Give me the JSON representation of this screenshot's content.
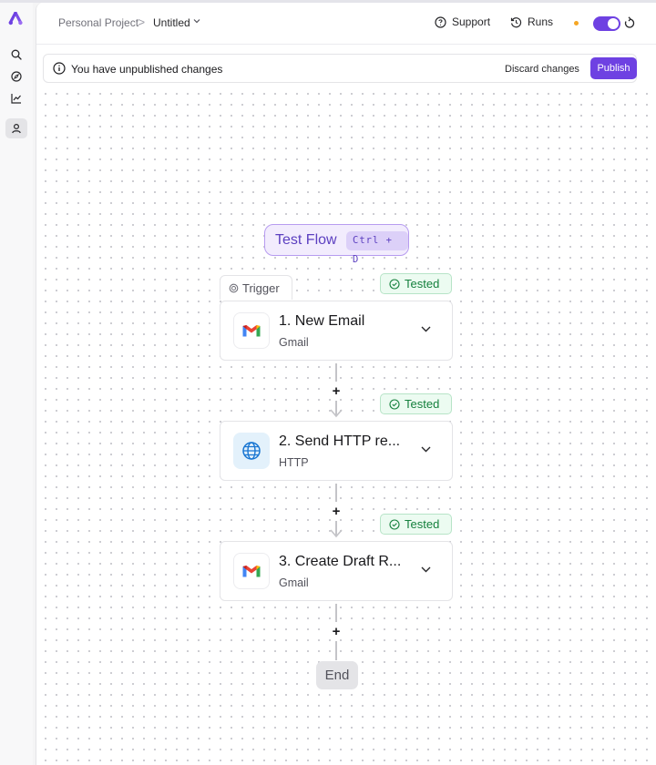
{
  "header": {
    "breadcrumb_project": "Personal Project",
    "breadcrumb_separator": ">",
    "breadcrumb_title": "Untitled",
    "support_label": "Support",
    "runs_label": "Runs",
    "status_dot_color": "#f5a623",
    "toggle_on": true,
    "accent_color": "#6e41e2"
  },
  "sidebar": {
    "items": [
      {
        "icon": "search-icon"
      },
      {
        "icon": "compass-icon"
      },
      {
        "icon": "chart-icon"
      },
      {
        "icon": "user-icon",
        "active": true
      }
    ]
  },
  "banner": {
    "message": "You have unpublished changes",
    "discard_label": "Discard changes",
    "publish_label": "Publish"
  },
  "flow": {
    "test_flow_label": "Test Flow",
    "test_flow_shortcut": "Ctrl + D",
    "trigger_label": "Trigger",
    "tested_label": "Tested",
    "steps": [
      {
        "title": "1. New Email",
        "subtitle": "Gmail",
        "icon": "gmail-icon",
        "status": "Tested"
      },
      {
        "title": "2. Send HTTP re...",
        "subtitle": "HTTP",
        "icon": "globe-icon",
        "status": "Tested"
      },
      {
        "title": "3. Create Draft R...",
        "subtitle": "Gmail",
        "icon": "gmail-icon",
        "status": "Tested"
      }
    ],
    "add_label": "+",
    "end_label": "End"
  }
}
